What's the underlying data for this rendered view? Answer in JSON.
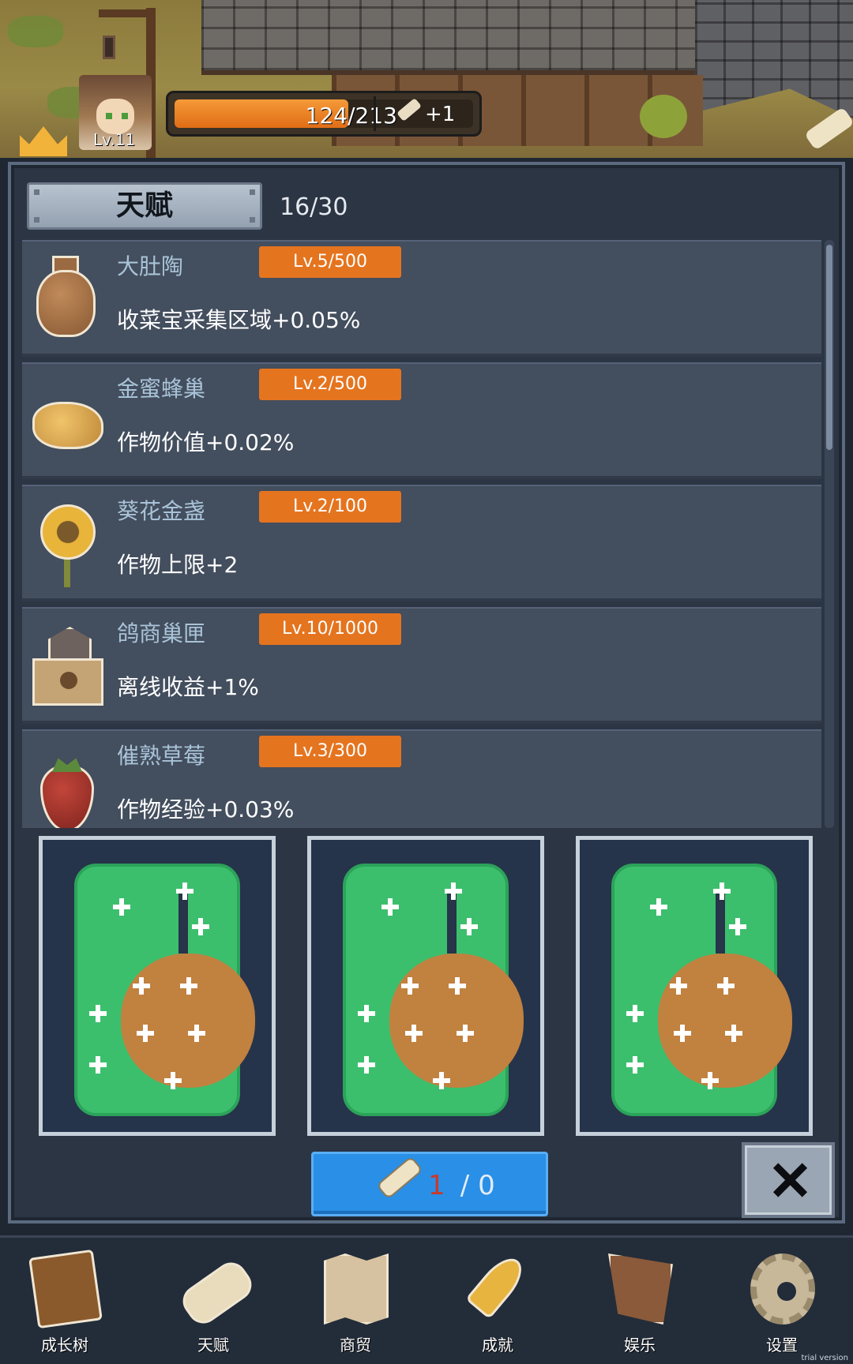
{
  "hud": {
    "player_level": "Lv.11",
    "xp_text": "124/213",
    "xp_fraction": 0.582,
    "scroll_bonus": "+1"
  },
  "panel": {
    "title": "天赋",
    "count": "16/30"
  },
  "talents": [
    {
      "icon": "clay-pot-icon",
      "name": "大肚陶",
      "level": "Lv.5/500",
      "effect": "收菜宝采集区域+0.05%"
    },
    {
      "icon": "honeycomb-icon",
      "name": "金蜜蜂巢",
      "level": "Lv.2/500",
      "effect": "作物价值+0.02%"
    },
    {
      "icon": "sunflower-icon",
      "name": "葵花金盏",
      "level": "Lv.2/100",
      "effect": "作物上限+2"
    },
    {
      "icon": "pigeon-nest-icon",
      "name": "鸽商巢匣",
      "level": "Lv.10/1000",
      "effect": "离线收益+1%"
    },
    {
      "icon": "strawberry-icon",
      "name": "催熟草莓",
      "level": "Lv.3/300",
      "effect": "作物经验+0.03%"
    }
  ],
  "cards": [
    "melon-card-icon",
    "melon-card-icon",
    "melon-card-icon"
  ],
  "draw_button": {
    "owned": "1",
    "separator": " / 0"
  },
  "nav": [
    {
      "icon": "book-icon",
      "label": "成长树"
    },
    {
      "icon": "scroll-icon",
      "label": "天赋"
    },
    {
      "icon": "map-icon",
      "label": "商贸"
    },
    {
      "icon": "key-icon",
      "label": "成就"
    },
    {
      "icon": "leather-icon",
      "label": "娱乐"
    },
    {
      "icon": "gear-icon",
      "label": "设置"
    }
  ],
  "footer": {
    "trial": "trial version"
  },
  "colors": {
    "panel_bg": "#2b3544",
    "row_bg": "#434e5e",
    "level_badge": "#e5741f",
    "talent_name": "#a9c3d8",
    "xp_bar": "#e06d16",
    "draw_button": "#2a8fe6",
    "card_green": "#3cbf6d"
  }
}
